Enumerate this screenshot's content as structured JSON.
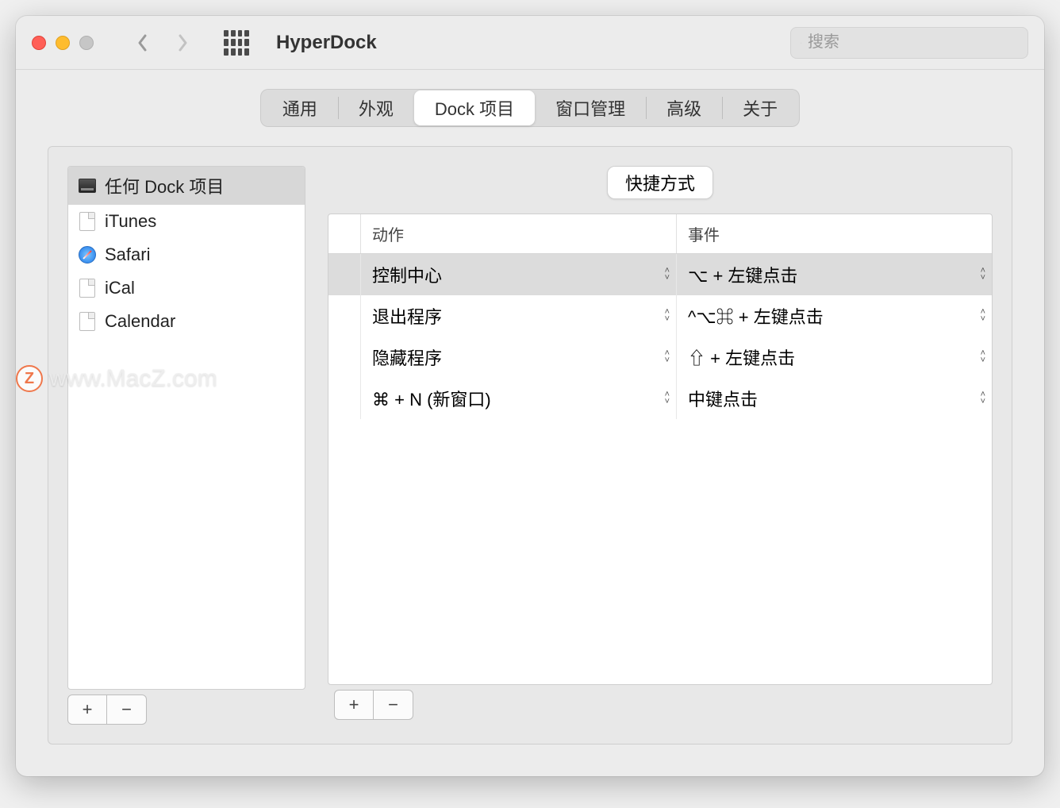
{
  "window_title": "HyperDock",
  "search": {
    "placeholder": "搜索"
  },
  "tabs": [
    {
      "label": "通用"
    },
    {
      "label": "外观"
    },
    {
      "label": "Dock 项目",
      "active": true
    },
    {
      "label": "窗口管理"
    },
    {
      "label": "高级"
    },
    {
      "label": "关于"
    }
  ],
  "sidebar": {
    "items": [
      {
        "label": "任何 Dock 项目",
        "icon": "dock",
        "selected": true
      },
      {
        "label": "iTunes",
        "icon": "file"
      },
      {
        "label": "Safari",
        "icon": "safari"
      },
      {
        "label": "iCal",
        "icon": "file"
      },
      {
        "label": "Calendar",
        "icon": "file"
      }
    ],
    "add_label": "+",
    "remove_label": "−"
  },
  "subtab": {
    "label": "快捷方式"
  },
  "table": {
    "headers": {
      "action": "动作",
      "event": "事件"
    },
    "rows": [
      {
        "action": "控制中心",
        "event": "⌥ + 左键点击",
        "selected": true
      },
      {
        "action": "退出程序",
        "event": "^⌥⌘ + 左键点击"
      },
      {
        "action": "隐藏程序",
        "event": "⇧ + 左键点击"
      },
      {
        "action": "⌘ + N (新窗口)",
        "event": "中键点击"
      }
    ],
    "add_label": "+",
    "remove_label": "−"
  },
  "watermark": {
    "badge": "Z",
    "text": "www.MacZ.com"
  }
}
